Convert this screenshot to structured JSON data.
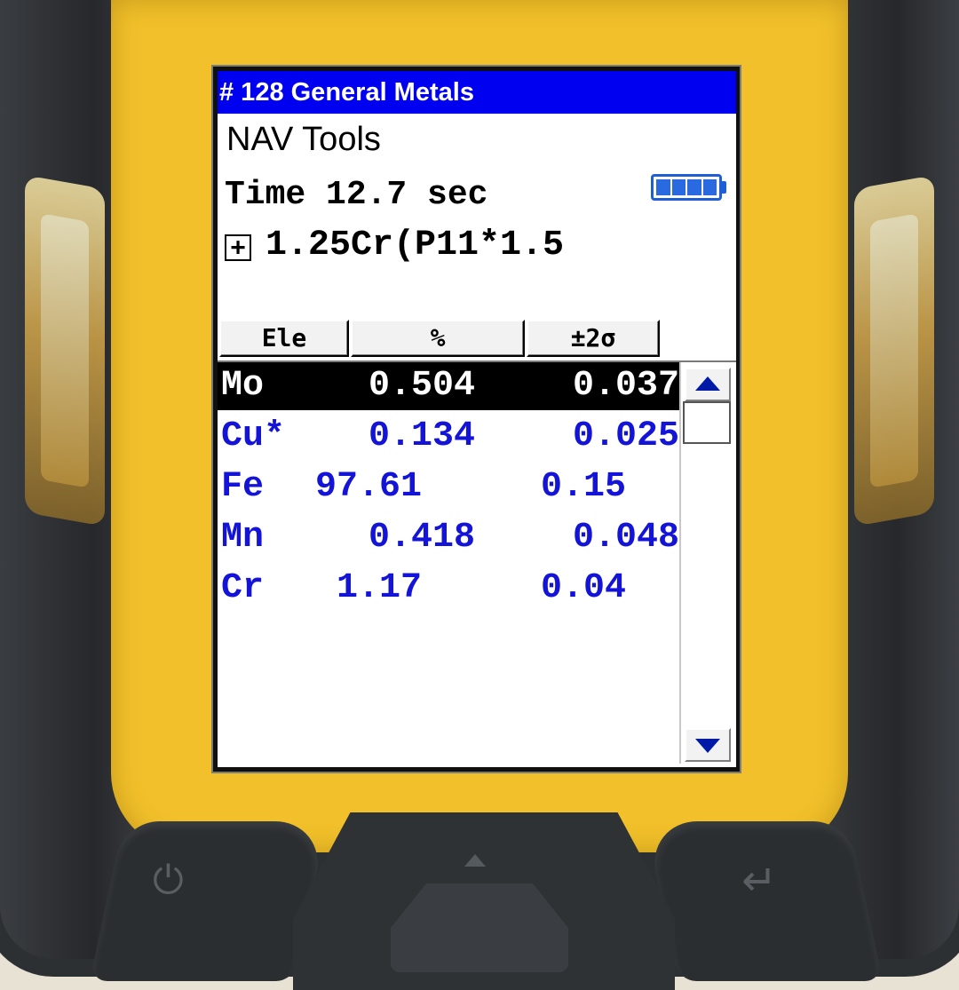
{
  "title_bar": "# 128 General Metals",
  "menu_title": "NAV Tools",
  "time": {
    "text": "Time 12.7 sec"
  },
  "battery_level": 1.0,
  "alloy_match": {
    "expand_glyph": "+",
    "text": "1.25Cr(P11*1.5"
  },
  "columns": {
    "element": "Ele",
    "percent": "%",
    "error": "±2σ"
  },
  "rows": [
    {
      "element": "Mo",
      "value": "0.504",
      "error": "0.037",
      "selected": true
    },
    {
      "element": "Cu*",
      "value": "0.134",
      "error": "0.025",
      "selected": false
    },
    {
      "element": "Fe",
      "value": "97.61",
      "error": "0.15",
      "selected": false
    },
    {
      "element": "Mn",
      "value": "0.418",
      "error": "0.048",
      "selected": false
    },
    {
      "element": "Cr",
      "value": "1.17",
      "error": "0.04",
      "selected": false
    }
  ],
  "colors": {
    "title_bar_bg": "#0000f0",
    "row_text": "#1414d8",
    "selected_bg": "#000000",
    "device_yellow": "#f1c02a"
  },
  "icons": {
    "power": "power-icon",
    "enter": "enter-icon",
    "battery": "battery-icon",
    "scroll_up": "scroll-up-arrow-icon",
    "scroll_down": "scroll-down-arrow-icon"
  }
}
